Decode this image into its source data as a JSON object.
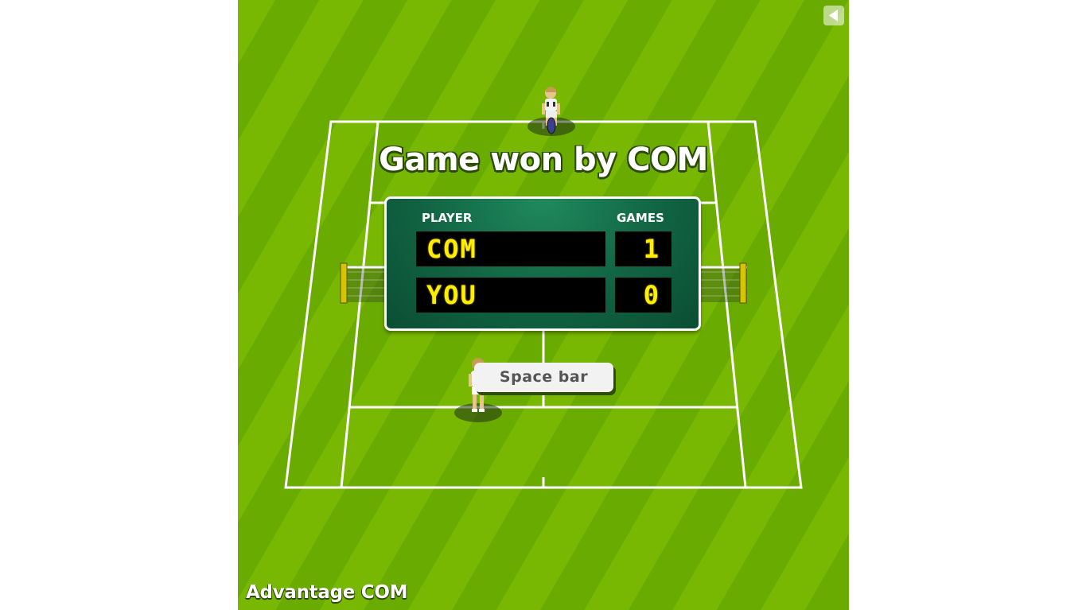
{
  "game": {
    "title": "Game won by COM",
    "scoreboard": {
      "player_header": "PLAYER",
      "games_header": "GAMES",
      "rows": [
        {
          "name": "COM",
          "games": "1"
        },
        {
          "name": "YOU",
          "games": "0"
        }
      ]
    },
    "prompt_button": "Space bar",
    "status": "Advantage COM",
    "back_icon": "triangle-left-icon"
  },
  "colors": {
    "grass_dark": "#6aab00",
    "grass_light": "#78b802",
    "scoreboard": "#116343",
    "led_text": "#ffee00"
  }
}
